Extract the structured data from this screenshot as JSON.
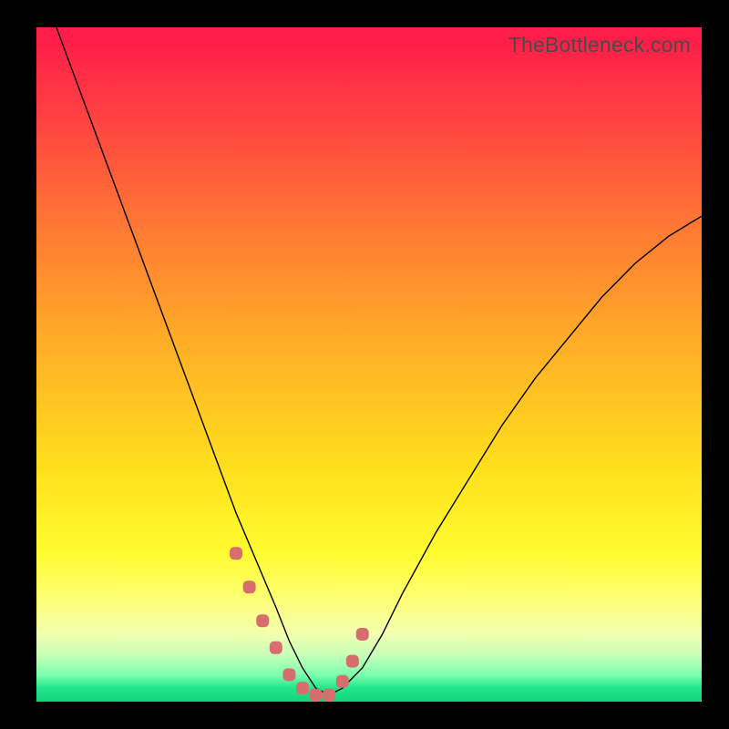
{
  "watermark": "TheBottleneck.com",
  "chart_data": {
    "type": "line",
    "title": "",
    "xlabel": "",
    "ylabel": "",
    "xlim": [
      0,
      100
    ],
    "ylim": [
      0,
      100
    ],
    "series": [
      {
        "name": "bottleneck-curve",
        "x": [
          3,
          6,
          9,
          12,
          15,
          18,
          21,
          24,
          27,
          30,
          33,
          36,
          38,
          40,
          42,
          44,
          46,
          49,
          52,
          55,
          60,
          65,
          70,
          75,
          80,
          85,
          90,
          95,
          100
        ],
        "y": [
          100,
          92,
          84,
          76,
          68,
          60,
          52,
          44,
          36,
          28,
          21,
          14,
          9,
          5,
          2,
          1,
          2,
          5,
          10,
          16,
          25,
          33,
          41,
          48,
          54,
          60,
          65,
          69,
          72
        ]
      }
    ],
    "markers": {
      "name": "highlight-points",
      "x": [
        30,
        32,
        34,
        36,
        38,
        40,
        42,
        44,
        46,
        47.5,
        49
      ],
      "y": [
        22,
        17,
        12,
        8,
        4,
        2,
        1,
        1,
        3,
        6,
        10
      ]
    }
  }
}
